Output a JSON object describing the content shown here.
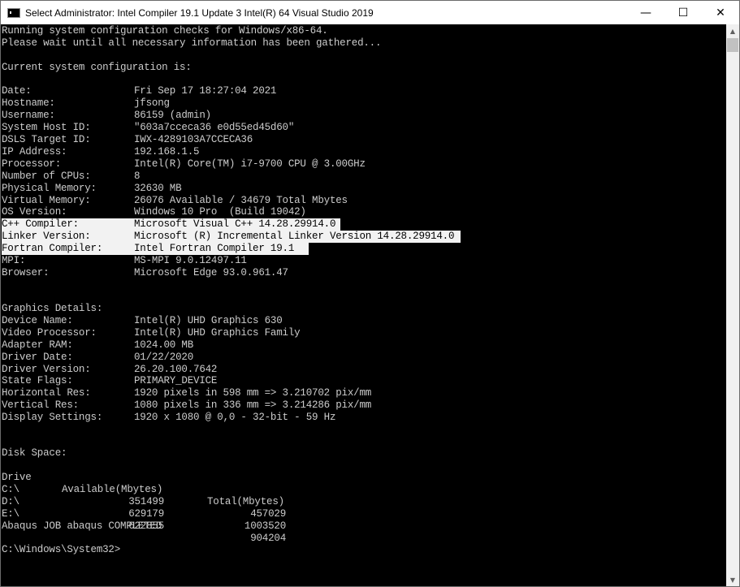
{
  "window": {
    "title": "Select Administrator:  Intel Compiler 19.1 Update 3 Intel(R) 64 Visual Studio 2019",
    "minimize": "—",
    "maximize": "☐",
    "close": "✕"
  },
  "console": {
    "intro1": "Running system configuration checks for Windows/x86-64.",
    "intro2": "Please wait until all necessary information has been gathered...",
    "current": "Current system configuration is:",
    "system": [
      {
        "label": "Date:",
        "value": "Fri Sep 17 18:27:04 2021"
      },
      {
        "label": "Hostname:",
        "value": "jfsong"
      },
      {
        "label": "Username:",
        "value": "86159 (admin)"
      },
      {
        "label": "System Host ID:",
        "value": "\"603a7cceca36 e0d55ed45d60\""
      },
      {
        "label": "DSLS Target ID:",
        "value": "IWX-4289103A7CCECA36"
      },
      {
        "label": "IP Address:",
        "value": "192.168.1.5"
      },
      {
        "label": "Processor:",
        "value": "Intel(R) Core(TM) i7-9700 CPU @ 3.00GHz"
      },
      {
        "label": "Number of CPUs:",
        "value": "8"
      },
      {
        "label": "Physical Memory:",
        "value": "32630 MB"
      },
      {
        "label": "Virtual Memory:",
        "value": "26076 Available / 34679 Total Mbytes"
      },
      {
        "label": "OS Version:",
        "value": "Windows 10 Pro  (Build 19042)"
      },
      {
        "label": "C++ Compiler:",
        "value": "Microsoft Visual C++ 14.28.29914.0"
      },
      {
        "label": "Linker Version:",
        "value": "Microsoft (R) Incremental Linker Version 14.28.29914.0"
      },
      {
        "label": "Fortran Compiler:",
        "value": "Intel Fortran Compiler 19.1"
      },
      {
        "label": "MPI:",
        "value": "MS-MPI 9.0.12497.11"
      },
      {
        "label": "Browser:",
        "value": "Microsoft Edge 93.0.961.47"
      }
    ],
    "graphics_header": "Graphics Details:",
    "graphics": [
      {
        "label": "Device Name:",
        "value": "Intel(R) UHD Graphics 630"
      },
      {
        "label": "Video Processor:",
        "value": "Intel(R) UHD Graphics Family"
      },
      {
        "label": "Adapter RAM:",
        "value": "1024.00 MB"
      },
      {
        "label": "Driver Date:",
        "value": "01/22/2020"
      },
      {
        "label": "Driver Version:",
        "value": "26.20.100.7642"
      },
      {
        "label": "State Flags:",
        "value": "PRIMARY_DEVICE"
      },
      {
        "label": "Horizontal Res:",
        "value": "1920 pixels in 598 mm => 3.210702 pix/mm"
      },
      {
        "label": "Vertical Res:",
        "value": "1080 pixels in 336 mm => 3.214286 pix/mm"
      },
      {
        "label": "Display Settings:",
        "value": "1920 x 1080 @ 0,0 - 32-bit - 59 Hz"
      }
    ],
    "disk_header": "Disk Space:",
    "disk_cols": {
      "drive": "Drive",
      "available": "Available(Mbytes)",
      "total": "Total(Mbytes)"
    },
    "disks": [
      {
        "drive": "C:\\",
        "available": "351499",
        "total": "457029"
      },
      {
        "drive": "D:\\",
        "available": "629179",
        "total": "1003520"
      },
      {
        "drive": "E:\\",
        "available": "622855",
        "total": "904204"
      }
    ],
    "completed": "Abaqus JOB abaqus COMPLETED",
    "prompt": "C:\\Windows\\System32>"
  },
  "scrollbar": {
    "up": "▲",
    "down": "▼"
  }
}
